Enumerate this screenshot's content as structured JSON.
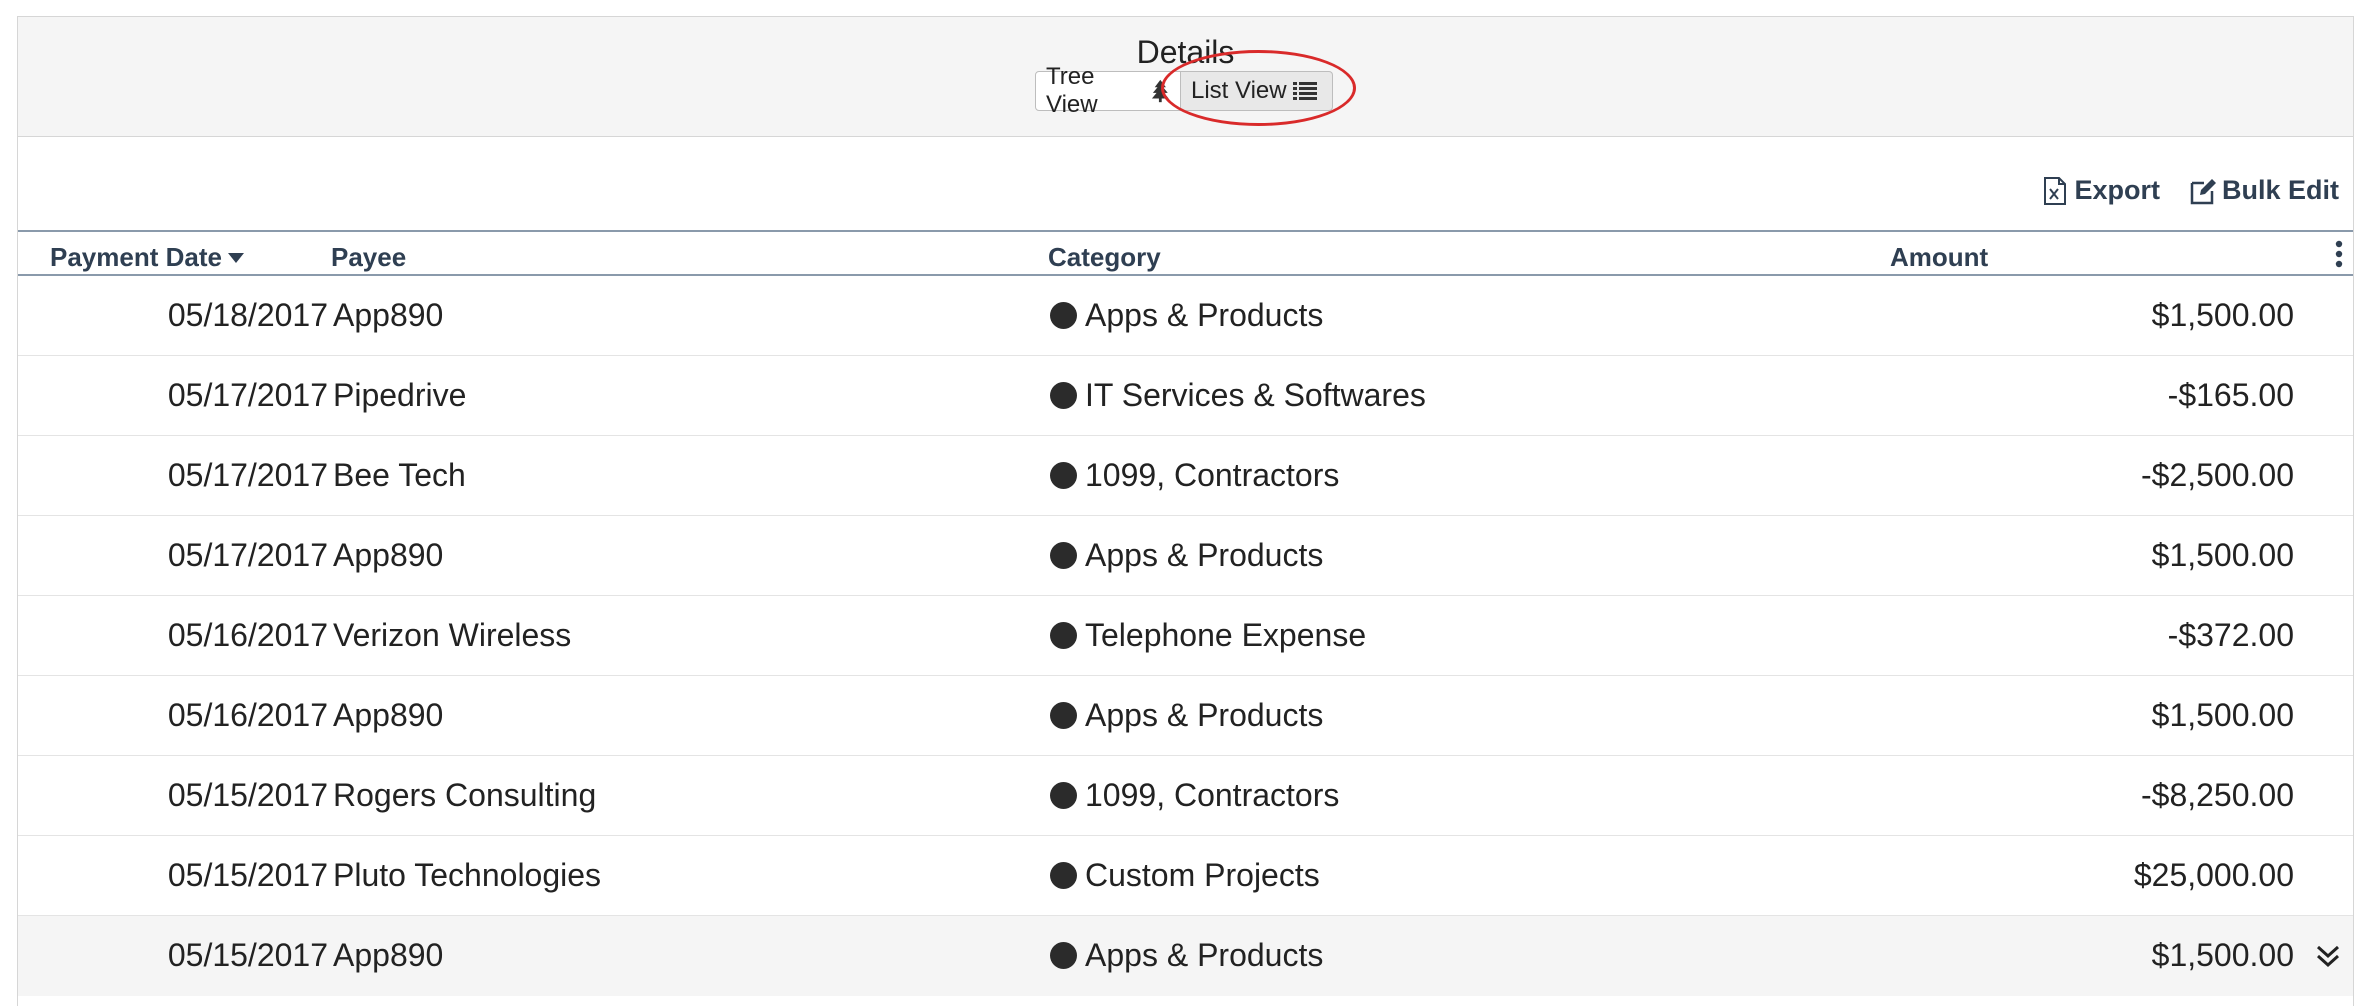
{
  "panel": {
    "title": "Details",
    "view_toggle": {
      "tree_label": "Tree View",
      "list_label": "List View"
    }
  },
  "toolbar": {
    "export_label": "Export",
    "bulk_edit_label": "Bulk Edit"
  },
  "table": {
    "columns": [
      "Payment Date",
      "Payee",
      "Category",
      "Amount"
    ],
    "rows": [
      {
        "date": "05/18/2017",
        "payee": "App890",
        "category": "Apps & Products",
        "amount": "$1,500.00"
      },
      {
        "date": "05/17/2017",
        "payee": "Pipedrive",
        "category": "IT Services & Softwares",
        "amount": "-$165.00"
      },
      {
        "date": "05/17/2017",
        "payee": "Bee Tech",
        "category": "1099, Contractors",
        "amount": "-$2,500.00"
      },
      {
        "date": "05/17/2017",
        "payee": "App890",
        "category": "Apps & Products",
        "amount": "$1,500.00"
      },
      {
        "date": "05/16/2017",
        "payee": "Verizon Wireless",
        "category": "Telephone Expense",
        "amount": "-$372.00"
      },
      {
        "date": "05/16/2017",
        "payee": "App890",
        "category": "Apps & Products",
        "amount": "$1,500.00"
      },
      {
        "date": "05/15/2017",
        "payee": "Rogers Consulting",
        "category": "1099, Contractors",
        "amount": "-$8,250.00"
      },
      {
        "date": "05/15/2017",
        "payee": "Pluto Technologies",
        "category": "Custom Projects",
        "amount": "$25,000.00"
      },
      {
        "date": "05/15/2017",
        "payee": "App890",
        "category": "Apps & Products",
        "amount": "$1,500.00"
      }
    ]
  },
  "colors": {
    "accent_ring": "#d92a2a",
    "header_text": "#2f3f52",
    "category_dot": "#2b2b2b"
  },
  "icons": {
    "tree_view": "tree-icon",
    "list_view": "list-icon",
    "export": "excel-file-icon",
    "bulk_edit": "edit-icon",
    "sort": "caret-down-icon",
    "column_menu": "vertical-dots-icon",
    "row_expand": "double-chevron-down-icon"
  }
}
